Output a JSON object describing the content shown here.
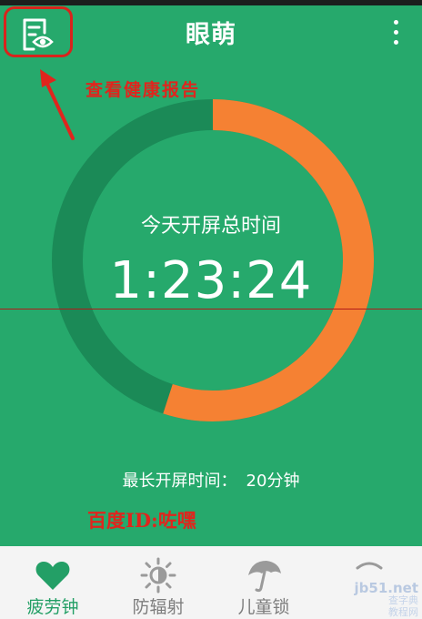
{
  "header": {
    "title": "眼萌",
    "report_button_icon": "report-eye-icon",
    "menu_icon": "overflow-menu-icon"
  },
  "annotation": {
    "report_hint": "查看健康报告"
  },
  "progress": {
    "label": "今天开屏总时间",
    "time": "1:23:24",
    "fraction": 0.55,
    "colors": {
      "fill": "#f58133",
      "track": "#1b8a57",
      "background": "#26a96c"
    }
  },
  "stats": {
    "longest_label": "最长开屏时间：",
    "longest_value": "20分钟"
  },
  "caption": {
    "baidu_id": "百度ID:咗嘿"
  },
  "tabs": [
    {
      "label": "疲劳钟",
      "icon": "heart-icon",
      "active": true
    },
    {
      "label": "防辐射",
      "icon": "sun-icon",
      "active": false
    },
    {
      "label": "儿童锁",
      "icon": "umbrella-icon",
      "active": false
    },
    {
      "label": "",
      "icon": "more-icon",
      "active": false
    }
  ],
  "watermark": {
    "site": "jb51.net",
    "line1": "查字典",
    "line2": "教程网"
  }
}
